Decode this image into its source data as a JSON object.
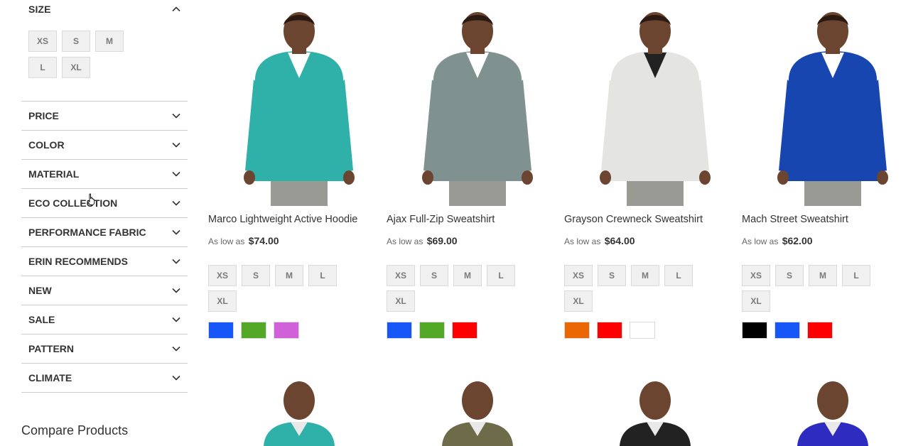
{
  "filters": {
    "size": {
      "title": "SIZE",
      "options": [
        "XS",
        "S",
        "M",
        "L",
        "XL"
      ]
    },
    "items": [
      {
        "label": "PRICE"
      },
      {
        "label": "COLOR"
      },
      {
        "label": "MATERIAL"
      },
      {
        "label": "ECO COLLECTION"
      },
      {
        "label": "PERFORMANCE FABRIC"
      },
      {
        "label": "ERIN RECOMMENDS"
      },
      {
        "label": "NEW"
      },
      {
        "label": "SALE"
      },
      {
        "label": "PATTERN"
      },
      {
        "label": "CLIMATE"
      }
    ]
  },
  "compare": {
    "title": "Compare Products"
  },
  "products": [
    {
      "name": "Marco Lightweight Active Hoodie",
      "price_prefix": "As low as",
      "price": "$74.00",
      "sizes": [
        "XS",
        "S",
        "M",
        "L",
        "XL"
      ],
      "colors": [
        "#1857f7",
        "#53a828",
        "#d161d8"
      ],
      "garment_color": "#2fb0a8"
    },
    {
      "name": "Ajax Full-Zip Sweatshirt",
      "price_prefix": "As low as",
      "price": "$69.00",
      "sizes": [
        "XS",
        "S",
        "M",
        "L",
        "XL"
      ],
      "colors": [
        "#1857f7",
        "#53a828",
        "#ff0000"
      ],
      "garment_color": "#7f9290"
    },
    {
      "name": "Grayson Crewneck Sweatshirt",
      "price_prefix": "As low as",
      "price": "$64.00",
      "sizes": [
        "XS",
        "S",
        "M",
        "L",
        "XL"
      ],
      "colors": [
        "#eb6703",
        "#ff0000",
        "#ffffff"
      ],
      "garment_color": "#e4e4e2"
    },
    {
      "name": "Mach Street Sweatshirt",
      "price_prefix": "As low as",
      "price": "$62.00",
      "sizes": [
        "XS",
        "S",
        "M",
        "L",
        "XL"
      ],
      "colors": [
        "#000000",
        "#1857f7",
        "#ff0000"
      ],
      "garment_color": "#1846b0"
    }
  ],
  "second_row_garments": [
    "#2fb0a8",
    "#6d6b4a",
    "#222222",
    "#2d2bc0"
  ]
}
